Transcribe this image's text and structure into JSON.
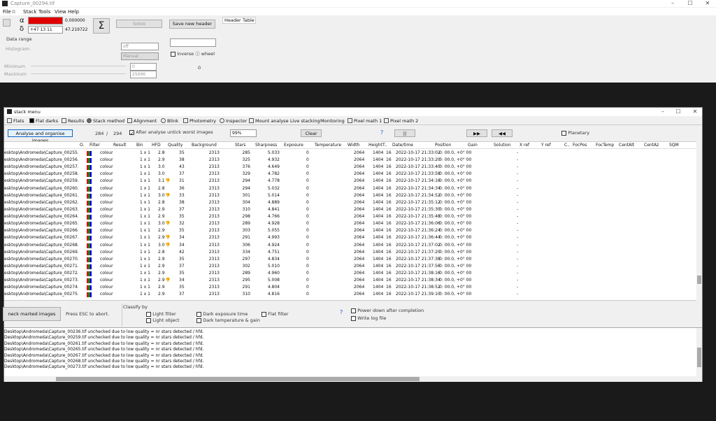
{
  "window": {
    "title": "Capture_00294.tif"
  },
  "menu": [
    "File",
    "Stack",
    "Tools",
    "View",
    "Help"
  ],
  "main": {
    "alpha_symbol": "α",
    "delta_symbol": "δ",
    "alpha_value": "0.000000",
    "dec_input": "+47 13 11",
    "dec_value": "47.219722",
    "sigma": "Σ",
    "solve": "Solve",
    "save_header": "Save new header",
    "tab_header": "Header",
    "tab_table": "Table",
    "data_range": "Data range",
    "histogram": "Histogram:",
    "hist_mode": "off",
    "hist_manual": "Manual",
    "minimum": "Minimum",
    "maximum": "Maximum",
    "min_value": "0",
    "max_value": "25696",
    "inverse_wheel": "Inverse ⓘ wheel",
    "zero": "0"
  },
  "stack": {
    "title": "stack menu",
    "tabs": [
      "Flats",
      "Flat darks",
      "Results",
      "Stack method",
      "Alignment",
      "Blink",
      "Photometry",
      "Inspector",
      "Mount analyse",
      "Live stacking",
      "Monitoring",
      "Pixel math 1",
      "Pixel math 2"
    ],
    "analyse_button": "Analyse and organise images",
    "count_a": "284",
    "count_sep": "/",
    "count_b": "294",
    "after_analyse": "After analyse untick worst images",
    "percent": "99%",
    "clear": "Clear",
    "help": "?",
    "pause": "||",
    "ffwd": "▶▶",
    "rew": "◀◀",
    "planetary": "Planetary",
    "columns": [
      "O.",
      "Filter",
      "Result",
      "Bin",
      "HFD",
      "Quality",
      "Background",
      "Stars",
      "Sharpness",
      "Exposure",
      "Temperature",
      "Width",
      "Height",
      "T..",
      "Date/time",
      "Position",
      "Gain",
      "Solution",
      "X ref",
      "Y ref",
      "C..",
      "FocPos",
      "FocTemp",
      "CentAlt",
      "CentAz",
      "SQM"
    ],
    "rows": [
      [
        "esktop\\Andromeda\\Capture_00255.tif",
        "colour",
        "1 x 1",
        "2.8",
        "35",
        "",
        "2313",
        "285",
        "5.033",
        "0",
        "2064",
        "1404",
        "16",
        "2022-10-17 21:33:02",
        "0: 00.0, +0° 00",
        "-"
      ],
      [
        "esktop\\Andromeda\\Capture_00256.tif",
        "colour",
        "1 x 1",
        "2.9",
        "38",
        "",
        "2313",
        "325",
        "4.932",
        "0",
        "2064",
        "1404",
        "16",
        "2022-10-17 21:33:20",
        "0: 00.0, +0° 00",
        "-"
      ],
      [
        "esktop\\Andromeda\\Capture_00257.tif",
        "colour",
        "1 x 1",
        "3.0",
        "43",
        "",
        "2313",
        "376",
        "4.649",
        "0",
        "2064",
        "1404",
        "16",
        "2022-10-17 21:33:40",
        "0: 00.0, +0° 00",
        "-"
      ],
      [
        "esktop\\Andromeda\\Capture_00258.tif",
        "colour",
        "1 x 1",
        "3.0",
        "37",
        "",
        "2313",
        "329",
        "4.782",
        "0",
        "2064",
        "1404",
        "16",
        "2022-10-17 21:33:58",
        "0: 00.0, +0° 00",
        "-"
      ],
      [
        "esktop\\Andromeda\\Capture_00259.tif",
        "colour",
        "1 x 1",
        "3.1",
        "31",
        "thumb",
        "2313",
        "294",
        "4.778",
        "0",
        "2064",
        "1404",
        "16",
        "2022-10-17 21:34:16",
        "0: 00.0, +0° 00",
        "-"
      ],
      [
        "esktop\\Andromeda\\Capture_00260.tif",
        "colour",
        "1 x 1",
        "2.8",
        "36",
        "",
        "2313",
        "294",
        "5.032",
        "0",
        "2064",
        "1404",
        "16",
        "2022-10-17 21:34:34",
        "0: 00.0, +0° 00",
        "-"
      ],
      [
        "esktop\\Andromeda\\Capture_00261.tif",
        "colour",
        "1 x 1",
        "3.0",
        "33",
        "thumb",
        "2313",
        "301",
        "5.014",
        "0",
        "2064",
        "1404",
        "16",
        "2022-10-17 21:34:52",
        "0: 00.0, +0° 00",
        "-"
      ],
      [
        "esktop\\Andromeda\\Capture_00262.tif",
        "colour",
        "1 x 1",
        "2.8",
        "38",
        "",
        "2313",
        "304",
        "4.889",
        "0",
        "2064",
        "1404",
        "16",
        "2022-10-17 21:35:12",
        "0: 00.0, +0° 00",
        "-"
      ],
      [
        "esktop\\Andromeda\\Capture_00263.tif",
        "colour",
        "1 x 1",
        "2.9",
        "37",
        "",
        "2313",
        "310",
        "4.841",
        "0",
        "2064",
        "1404",
        "16",
        "2022-10-17 21:35:30",
        "0: 00.0, +0° 00",
        "-"
      ],
      [
        "esktop\\Andromeda\\Capture_00264.tif",
        "colour",
        "1 x 1",
        "2.9",
        "35",
        "",
        "2313",
        "298",
        "4.766",
        "0",
        "2064",
        "1404",
        "16",
        "2022-10-17 21:35:48",
        "0: 00.0, +0° 00",
        "-"
      ],
      [
        "esktop\\Andromeda\\Capture_00265.tif",
        "colour",
        "1 x 1",
        "3.0",
        "32",
        "thumb",
        "2313",
        "289",
        "4.928",
        "0",
        "2064",
        "1404",
        "16",
        "2022-10-17 21:36:06",
        "0: 00.0, +0° 00",
        "-"
      ],
      [
        "esktop\\Andromeda\\Capture_00266.tif",
        "colour",
        "1 x 1",
        "2.9",
        "35",
        "",
        "2313",
        "303",
        "5.055",
        "0",
        "2064",
        "1404",
        "16",
        "2022-10-17 21:36:24",
        "0: 00.0, +0° 00",
        "-"
      ],
      [
        "esktop\\Andromeda\\Capture_00267.tif",
        "colour",
        "1 x 1",
        "2.9",
        "34",
        "thumb",
        "2313",
        "291",
        "4.993",
        "0",
        "2064",
        "1404",
        "16",
        "2022-10-17 21:36:44",
        "0: 00.0, +0° 00",
        "-"
      ],
      [
        "esktop\\Andromeda\\Capture_00268.tif",
        "colour",
        "1 x 1",
        "3.0",
        "34",
        "thumb",
        "2313",
        "306",
        "4.924",
        "0",
        "2064",
        "1404",
        "16",
        "2022-10-17 21:37:02",
        "0: 00.0, +0° 00",
        "-"
      ],
      [
        "esktop\\Andromeda\\Capture_00269.tif",
        "colour",
        "1 x 1",
        "2.8",
        "42",
        "",
        "2313",
        "334",
        "4.751",
        "0",
        "2064",
        "1404",
        "16",
        "2022-10-17 21:37:20",
        "0: 00.0, +0° 00",
        "-"
      ],
      [
        "esktop\\Andromeda\\Capture_00270.tif",
        "colour",
        "1 x 1",
        "2.9",
        "35",
        "",
        "2313",
        "297",
        "4.834",
        "0",
        "2064",
        "1404",
        "16",
        "2022-10-17 21:37:38",
        "0: 00.0, +0° 00",
        "-"
      ],
      [
        "esktop\\Andromeda\\Capture_00271.tif",
        "colour",
        "1 x 1",
        "2.9",
        "37",
        "",
        "2313",
        "302",
        "5.010",
        "0",
        "2064",
        "1404",
        "16",
        "2022-10-17 21:37:56",
        "0: 00.0, +0° 00",
        "-"
      ],
      [
        "esktop\\Andromeda\\Capture_00272.tif",
        "colour",
        "1 x 1",
        "2.9",
        "35",
        "",
        "2313",
        "289",
        "4.960",
        "0",
        "2064",
        "1404",
        "16",
        "2022-10-17 21:38:16",
        "0: 00.0, +0° 00",
        "-"
      ],
      [
        "esktop\\Andromeda\\Capture_00273.tif",
        "colour",
        "1 x 1",
        "2.9",
        "34",
        "thumb",
        "2313",
        "295",
        "5.008",
        "0",
        "2064",
        "1404",
        "16",
        "2022-10-17 21:38:34",
        "0: 00.0, +0° 00",
        "-"
      ],
      [
        "esktop\\Andromeda\\Capture_00274.tif",
        "colour",
        "1 x 1",
        "2.9",
        "35",
        "",
        "2313",
        "291",
        "4.804",
        "0",
        "2064",
        "1404",
        "16",
        "2022-10-17 21:38:52",
        "0: 00.0, +0° 00",
        "-"
      ],
      [
        "esktop\\Andromeda\\Capture_00275.tif",
        "colour",
        "1 x 1",
        "2.9",
        "37",
        "",
        "2313",
        "310",
        "4.816",
        "0",
        "2064",
        "1404",
        "16",
        "2022-10-17 21:39:10",
        "0: 00.0, +0° 00",
        "-"
      ]
    ],
    "uncheck_button": "neck marked images",
    "press_esc": "Press ESC to abort.",
    "classify_by": "Classify by",
    "light_filter": "Light filter",
    "light_object": "Light object",
    "dark_exposure": "Dark exposure time",
    "dark_temp": "Dark temperature & gain",
    "flat_filter": "Flat filter",
    "help2": "?",
    "power_down": "Power down after completion",
    "write_log": "Write log file",
    "log": [
      "Desktop\\Andromeda\\Capture_00236.tif unchecked due to low quality = nr stars detected / hfd.",
      "Desktop\\Andromeda\\Capture_00259.tif unchecked due to low quality = nr stars detected / hfd.",
      "Desktop\\Andromeda\\Capture_00261.tif unchecked due to low quality = nr stars detected / hfd.",
      "Desktop\\Andromeda\\Capture_00265.tif unchecked due to low quality = nr stars detected / hfd.",
      "Desktop\\Andromeda\\Capture_00267.tif unchecked due to low quality = nr stars detected / hfd.",
      "Desktop\\Andromeda\\Capture_00268.tif unchecked due to low quality = nr stars detected / hfd.",
      "Desktop\\Andromeda\\Capture_00273.tif unchecked due to low quality = nr stars detected / hfd."
    ]
  },
  "colors": {
    "accent": "#0a64c8",
    "alpha_field": "#e00000",
    "thumb": "#d4a800"
  }
}
